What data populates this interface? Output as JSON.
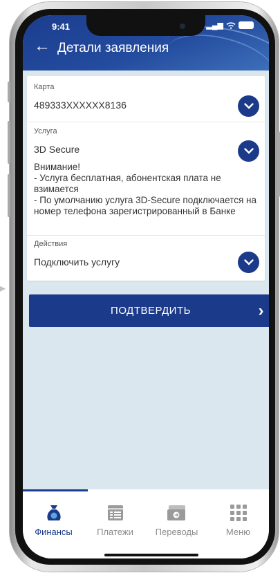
{
  "status": {
    "time": "9:41",
    "signal": "▂▄▆"
  },
  "header": {
    "back_symbol": "←",
    "title": "Детали заявления"
  },
  "card": {
    "card_field": {
      "label": "Карта",
      "value": "489333XXXXXX8136"
    },
    "service_field": {
      "label": "Услуга",
      "value": "3D Secure"
    },
    "notice_lines": [
      "Внимание!",
      " - Услуга бесплатная, абонентская плата не взимается",
      " - По умолчанию услуга 3D-Secure подключается на номер телефона зарегистрированный в Банке"
    ],
    "action_field": {
      "label": "Действия",
      "value": "Подключить услугу"
    }
  },
  "confirm": {
    "label": "ПОДТВЕРДИТЬ",
    "chevron": "›"
  },
  "nav": {
    "items": [
      {
        "label": "Финансы",
        "icon": "finance-bag-icon",
        "active": true
      },
      {
        "label": "Платежи",
        "icon": "payments-list-icon",
        "active": false
      },
      {
        "label": "Переводы",
        "icon": "transfers-card-icon",
        "active": false
      },
      {
        "label": "Меню",
        "icon": "menu-grid-icon",
        "active": false
      }
    ]
  },
  "colors": {
    "primary": "#1b3a8a",
    "screen_bg": "#dbe7ee",
    "header_start": "#1c3d8f",
    "header_end": "#3d6fb9",
    "inactive_nav": "#8c8c8c"
  }
}
